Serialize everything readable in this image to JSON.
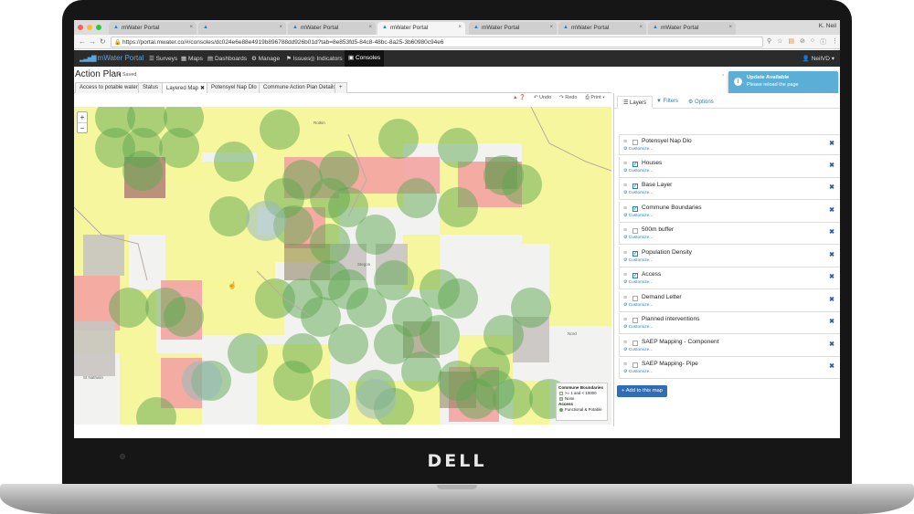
{
  "device": {
    "brand": "DELL"
  },
  "browser": {
    "tabs": [
      {
        "title": "mWater Portal",
        "active": false
      },
      {
        "title": "",
        "active": false
      },
      {
        "title": "mWater Portal",
        "active": false
      },
      {
        "title": "mWater Portal",
        "active": true
      },
      {
        "title": "mWater Portal",
        "active": false
      },
      {
        "title": "mWater Portal",
        "active": false
      },
      {
        "title": "mWater Portal",
        "active": false
      }
    ],
    "profile": "K. Neil",
    "url": "https://portal.mwater.co/#/consoles/dc024e6e88e4919b896788dd926b01d?tab=8e853fd5-84c8-48bc-8a25-3b60980c94e6"
  },
  "app": {
    "logo": "mWater Portal",
    "nav": [
      "Surveys",
      "Maps",
      "Dashboards",
      "Manage",
      "Issues",
      "Indicators",
      "Consoles"
    ],
    "user": "NeilVD"
  },
  "page": {
    "title": "Action Plan",
    "saved": "Saved",
    "tabs": [
      {
        "label": "Access to potable water",
        "active": false
      },
      {
        "label": "Status",
        "active": false
      },
      {
        "label": "Layered Map",
        "active": true
      },
      {
        "label": "Potensyel Nap Dlo",
        "active": false
      },
      {
        "label": "Commune Action Plan Details",
        "active": false
      }
    ],
    "add_tab": "+",
    "toolbar": {
      "undo": "Undo",
      "redo": "Redo",
      "print": "Print"
    }
  },
  "notification": {
    "title": "Update Available",
    "message": "Please reload the page"
  },
  "map": {
    "zoom_in": "+",
    "zoom_out": "−",
    "place_labels": [
      "Rotkin",
      "Stegon",
      "St Nathalin",
      "Nord"
    ],
    "legend": {
      "layer1_title": "Commune Boundaries",
      "layer1_items": [
        ">= 1 and < 10000",
        "None"
      ],
      "layer2_title": "Access",
      "layer2_items": [
        "Functional & Potable"
      ]
    },
    "colors": {
      "yellow": "#f6f59a",
      "red": "#f4a4a2",
      "gray": "#c8c4c2",
      "green": "#5ea84f",
      "blue": "#95b9bc",
      "brown": "#8a7d5d"
    }
  },
  "panel": {
    "tabs": [
      "Layers",
      "Filters",
      "Options"
    ],
    "layers": [
      {
        "name": "Potensyel Nap Dlo",
        "checked": false
      },
      {
        "name": "Houses",
        "checked": true
      },
      {
        "name": "Base Layer",
        "checked": true
      },
      {
        "name": "Commune Boundaries",
        "checked": true
      },
      {
        "name": "500m buffer",
        "checked": false
      },
      {
        "name": "Population Density",
        "checked": true
      },
      {
        "name": "Access",
        "checked": true
      },
      {
        "name": "Demand Letter",
        "checked": false
      },
      {
        "name": "Planned interventions",
        "checked": false
      },
      {
        "name": "SAEP Mapping - Component",
        "checked": false
      },
      {
        "name": "SAEP Mapping- Pipe",
        "checked": false
      }
    ],
    "customize_label": "Customize...",
    "add_button": "Add to this map"
  }
}
